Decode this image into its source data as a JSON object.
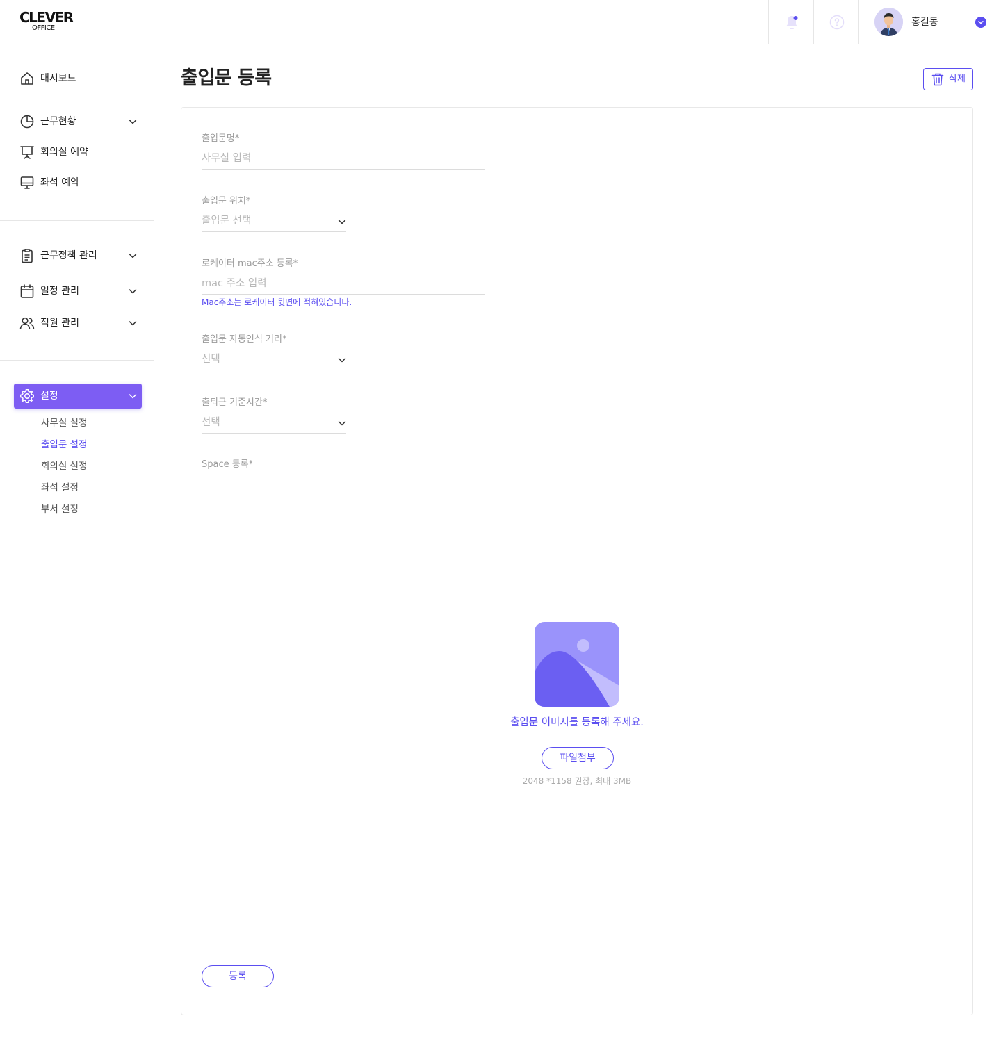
{
  "header": {
    "logo_main": "CLEVER",
    "logo_sub": "OFFICE",
    "user_name": "홍길동"
  },
  "sidebar": {
    "items": [
      {
        "label": "대시보드",
        "icon": "home-icon"
      },
      {
        "label": "근무현황",
        "icon": "pie-chart-icon"
      },
      {
        "label": "회의실 예약",
        "icon": "presentation-board-icon"
      },
      {
        "label": "좌석 예약",
        "icon": "monitor-icon"
      },
      {
        "label": "근무정책 관리",
        "icon": "clipboard-icon"
      },
      {
        "label": "일정 관리",
        "icon": "calendar-icon"
      },
      {
        "label": "직원 관리",
        "icon": "users-icon"
      },
      {
        "label": "설정",
        "icon": "gear-icon"
      }
    ],
    "settings_sub": [
      {
        "label": "사무실 설정"
      },
      {
        "label": "출입문 설정"
      },
      {
        "label": "회의실 설정"
      },
      {
        "label": "좌석 설정"
      },
      {
        "label": "부서 설정"
      }
    ]
  },
  "page": {
    "title": "출입문 등록",
    "delete_label": "삭제"
  },
  "form": {
    "name_label": "출입문명*",
    "name_placeholder": "사무실 입력",
    "location_label": "출입문 위치*",
    "location_placeholder": "출입문 선택",
    "mac_label": "로케이터 mac주소 등록*",
    "mac_placeholder": "mac 주소 입력",
    "mac_hint": "Mac주소는 로케이터 뒷면에 적혀있습니다.",
    "distance_label": "출입문 자동인식 거리*",
    "distance_placeholder": "선택",
    "time_label": "출퇴근 기준시간*",
    "time_placeholder": "선택",
    "space_label": "Space 등록*",
    "dropzone_text": "출입문 이미지를 등록해 주세요.",
    "attach_label": "파일첨부",
    "dropzone_note": "2048 *1158 권장, 최대 3MB",
    "submit_label": "등록"
  },
  "colors": {
    "accent": "#5b4ef0",
    "active_nav": "#7d5df3",
    "image_icon_bg": "#9a93fb",
    "image_icon_fg": "#6b5ff2"
  }
}
